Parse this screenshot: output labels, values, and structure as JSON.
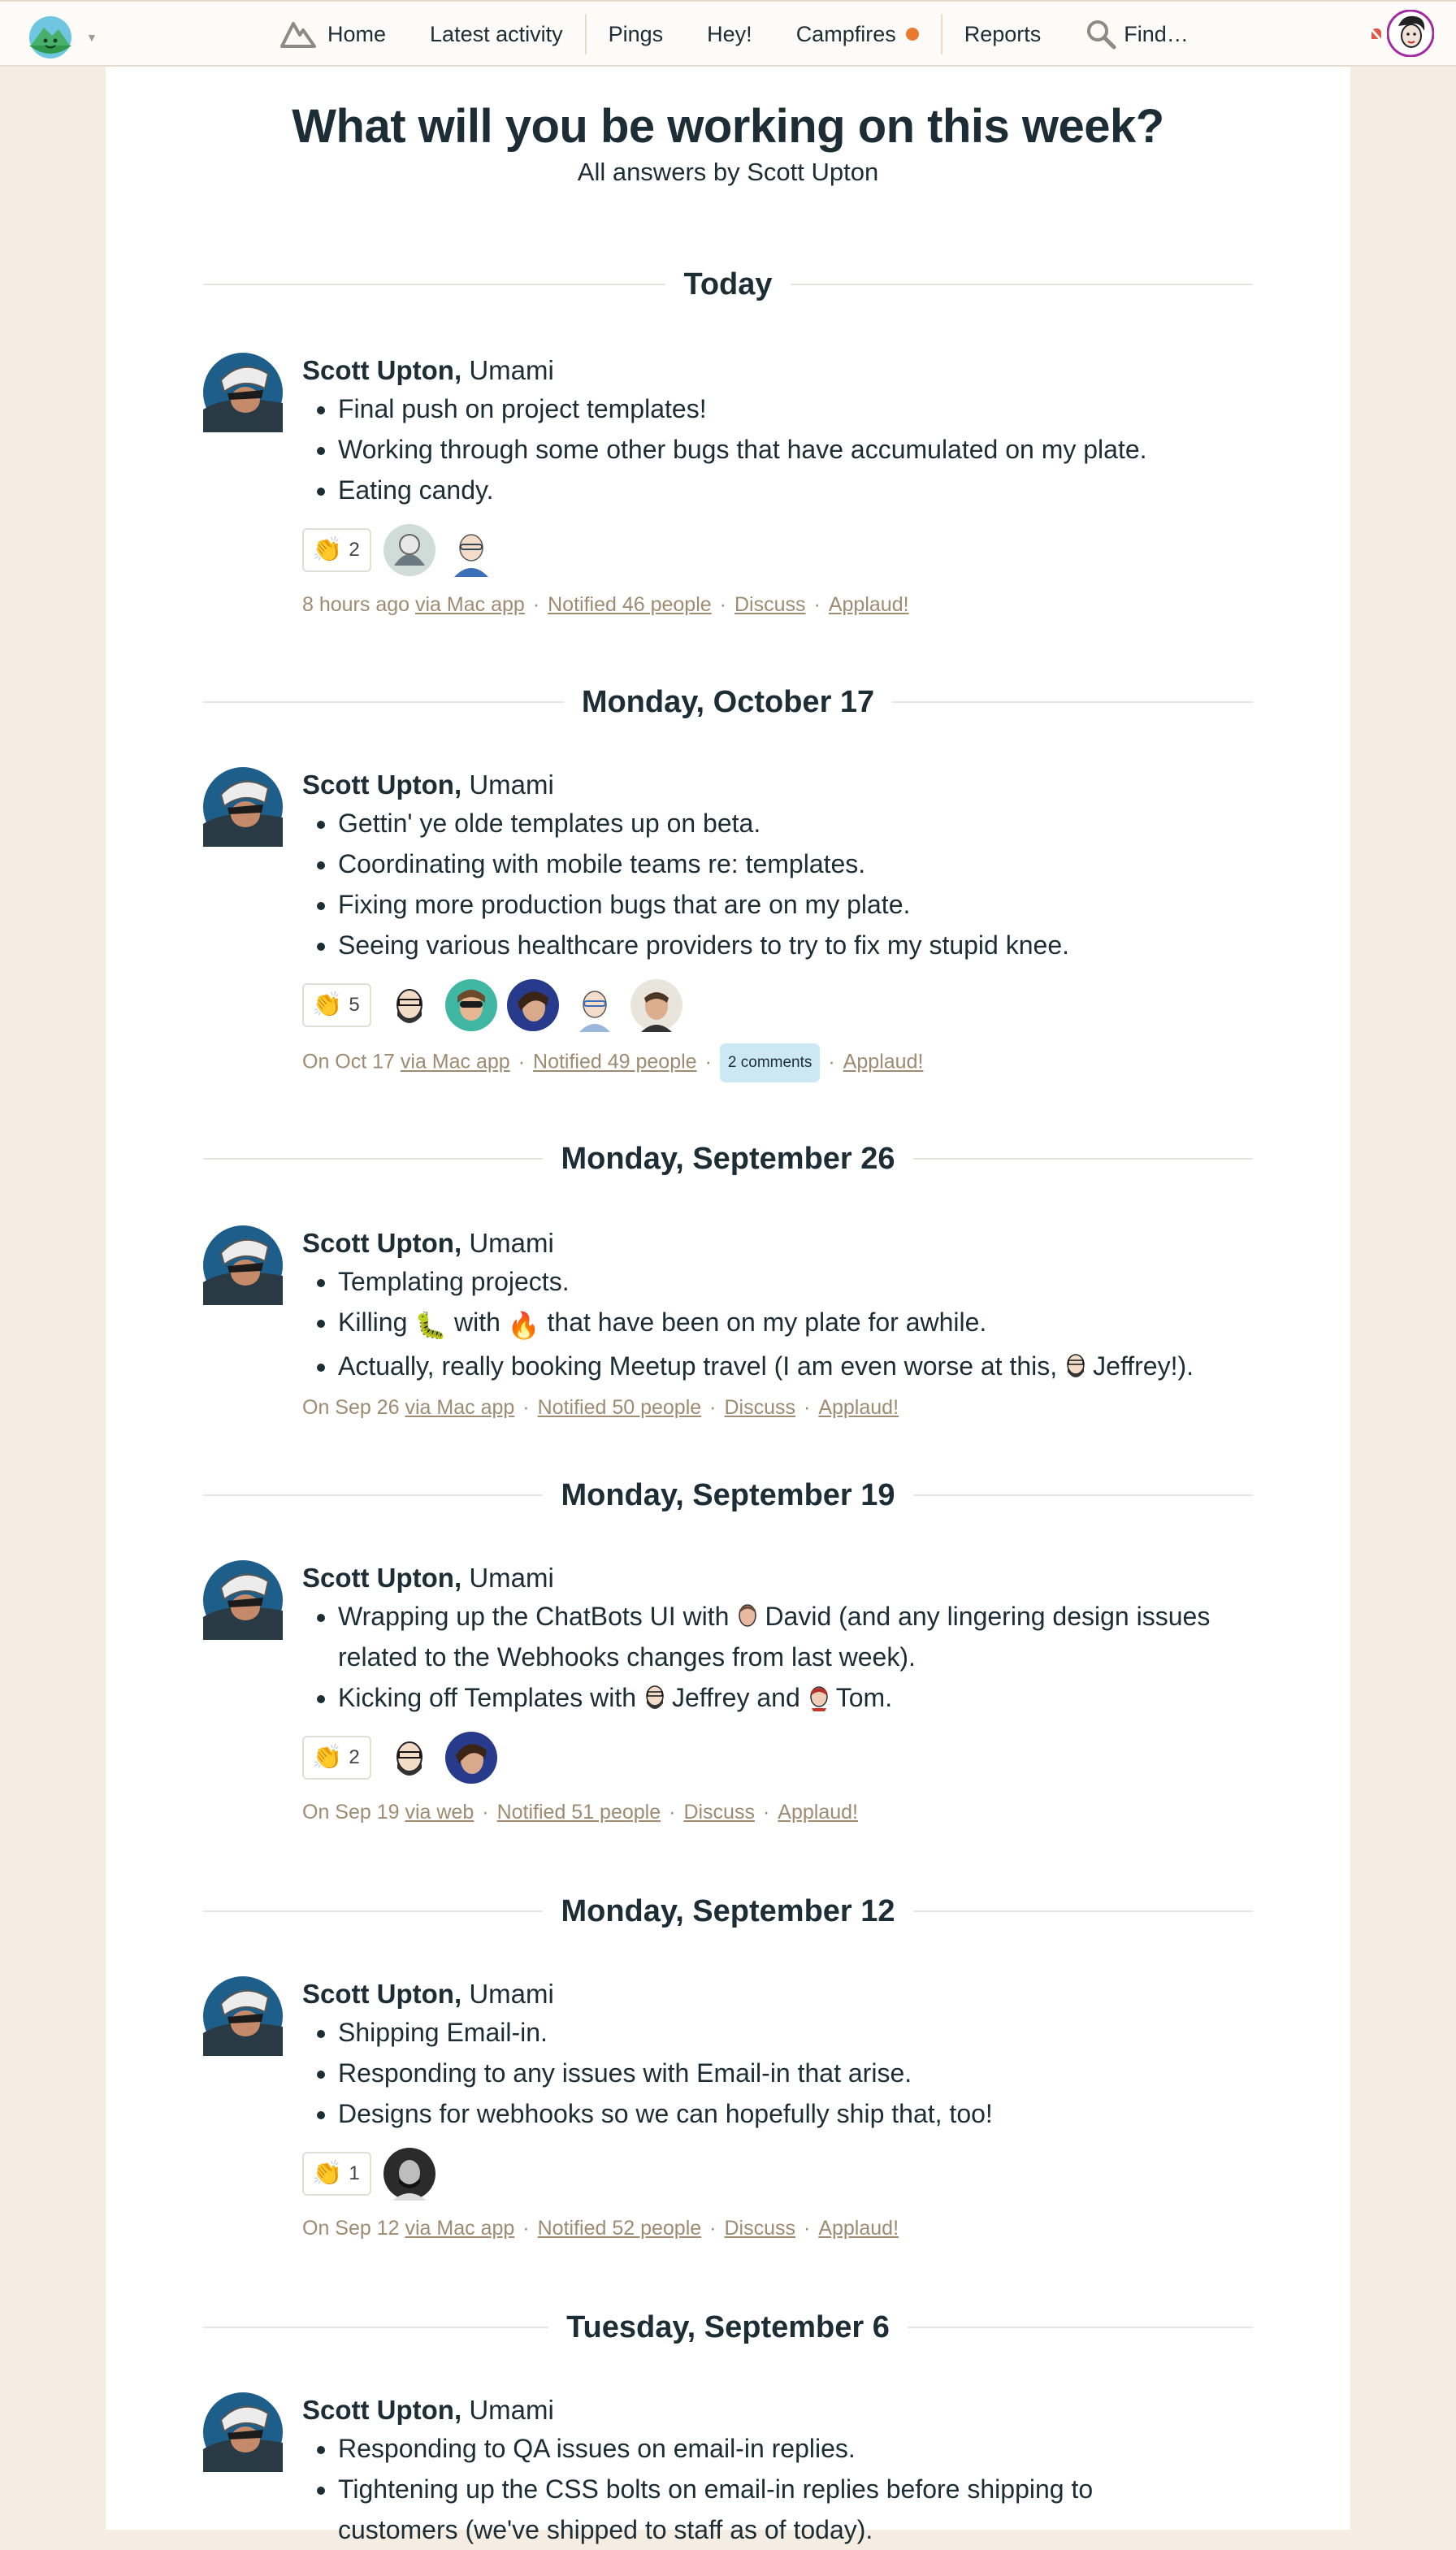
{
  "nav": {
    "home": "Home",
    "latest": "Latest activity",
    "pings": "Pings",
    "hey": "Hey!",
    "campfires": "Campfires",
    "reports": "Reports",
    "find": "Find…",
    "accent_dot_color": "#e87a2f"
  },
  "page": {
    "title": "What will you be working on this week?",
    "subtitle": "All answers by Scott Upton"
  },
  "author": {
    "name": "Scott Upton,",
    "team": "Umami"
  },
  "days": [
    {
      "heading": "Today",
      "lines": [
        "Final push on project templates!",
        "Working through some other bugs that have accumulated on my plate.",
        "Eating candy."
      ],
      "claps": "2",
      "meta": {
        "time": "8 hours ago",
        "via": "via Mac app",
        "notified": "Notified 46 people",
        "discuss": "Discuss",
        "applaud": "Applaud!"
      }
    },
    {
      "heading": "Monday, October 17",
      "lines": [
        "Gettin' ye olde templates up on beta.",
        "Coordinating with mobile teams re: templates.",
        "Fixing more production bugs that are on my plate.",
        "Seeing various healthcare providers to try to fix my stupid knee."
      ],
      "claps": "5",
      "meta": {
        "time": "On Oct 17",
        "via": "via Mac app",
        "notified": "Notified 49 people",
        "comments": "2 comments",
        "applaud": "Applaud!"
      }
    },
    {
      "heading": "Monday, September 26",
      "lines": {
        "l1": "Templating projects.",
        "l2a": "Killing",
        "l2b": "with",
        "l2c": "that have been on my plate for awhile.",
        "l3a": "Actually, really booking Meetup travel (I am even worse at this,",
        "l3b": "Jeffrey!)."
      },
      "meta": {
        "time": "On Sep 26",
        "via": "via Mac app",
        "notified": "Notified 50 people",
        "discuss": "Discuss",
        "applaud": "Applaud!"
      }
    },
    {
      "heading": "Monday, September 19",
      "lines": {
        "l1a": "Wrapping up the ChatBots UI with",
        "l1b": "David (and any lingering design issues related to the Webhooks changes from last week).",
        "l2a": "Kicking off Templates with",
        "l2b": "Jeffrey and",
        "l2c": "Tom."
      },
      "claps": "2",
      "meta": {
        "time": "On Sep 19",
        "via": "via web",
        "notified": "Notified 51 people",
        "discuss": "Discuss",
        "applaud": "Applaud!"
      }
    },
    {
      "heading": "Monday, September 12",
      "lines": [
        "Shipping Email-in.",
        "Responding to any issues with Email-in that arise.",
        "Designs for webhooks so we can hopefully ship that, too!"
      ],
      "claps": "1",
      "meta": {
        "time": "On Sep 12",
        "via": "via Mac app",
        "notified": "Notified 52 people",
        "discuss": "Discuss",
        "applaud": "Applaud!"
      }
    },
    {
      "heading": "Tuesday, September 6",
      "lines": [
        "Responding to QA issues on email-in replies.",
        "Tightening up the CSS bolts on email-in replies before shipping to",
        "customers (we've shipped to staff as of today)."
      ]
    }
  ],
  "icons": {
    "clap": "👏",
    "bug": "🐛",
    "fire": "🔥"
  }
}
